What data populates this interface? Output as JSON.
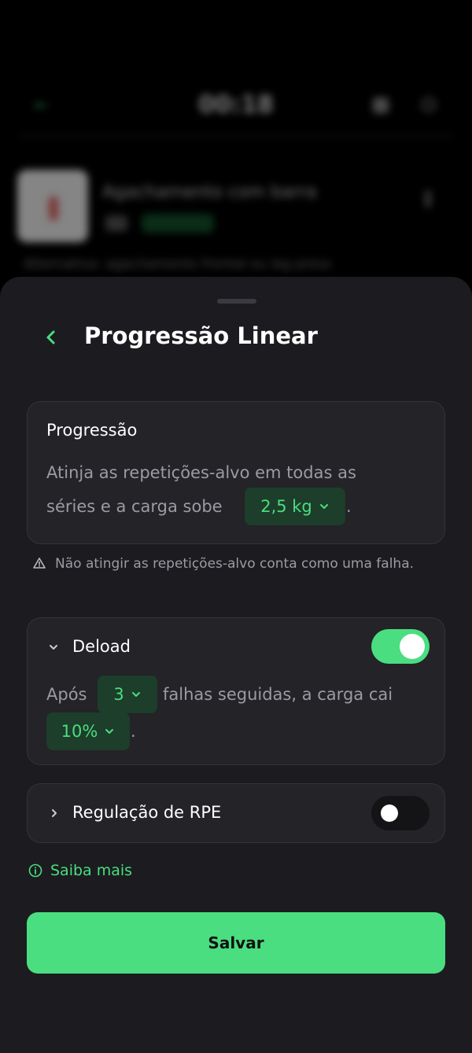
{
  "background": {
    "timer": "00:18",
    "exercise_title": "Agachamento com barra",
    "note": "Alternativa: agachamento frontal ou leg press"
  },
  "sheet": {
    "title": "Progressão Linear",
    "progression": {
      "heading": "Progressão",
      "text_line1": "Atinja as repetições-alvo em todas as",
      "text_line2": "séries e a carga sobe",
      "increment": "2,5 kg",
      "period": "."
    },
    "warning": "Não atingir as repetições-alvo conta como uma falha.",
    "deload": {
      "label": "Deload",
      "enabled": true,
      "prefix": "Após",
      "failures": "3",
      "middle": "falhas seguidas, a carga cai",
      "percent": "10%",
      "period": "."
    },
    "rpe": {
      "label": "Regulação de RPE",
      "enabled": false
    },
    "learn_more": "Saiba mais",
    "save_label": "Salvar"
  },
  "colors": {
    "accent": "#4ade80",
    "sheet_bg": "#1c1c20",
    "card_bg": "#232328",
    "pill_bg": "#1d3e2a"
  }
}
